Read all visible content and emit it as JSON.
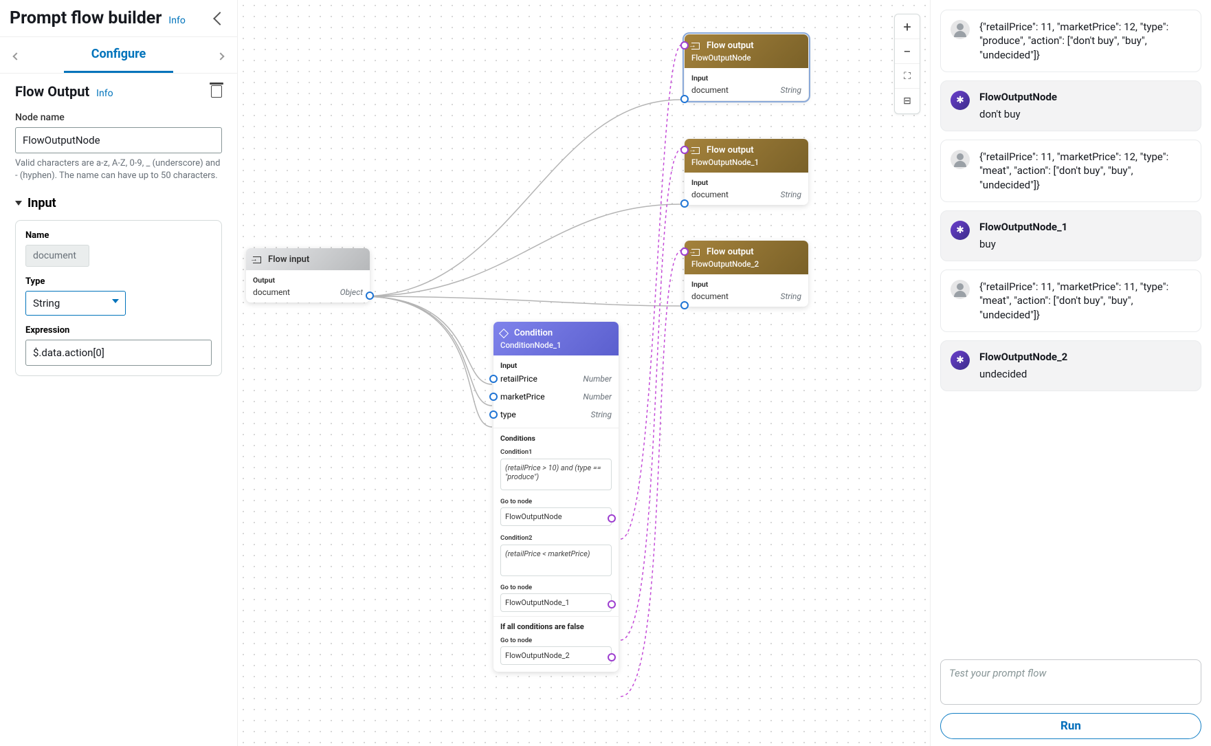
{
  "header": {
    "title": "Prompt flow builder",
    "info": "Info"
  },
  "tabs": {
    "active": "Configure"
  },
  "config": {
    "section_title": "Flow Output",
    "info": "Info",
    "node_name_label": "Node name",
    "node_name_value": "FlowOutputNode",
    "node_name_hint": "Valid characters are a-z, A-Z, 0-9, _ (underscore) and - (hyphen). The name can have up to 50 characters.",
    "input_header": "Input",
    "name_label": "Name",
    "name_value": "document",
    "type_label": "Type",
    "type_value": "String",
    "expr_label": "Expression",
    "expr_value": "$.data.action[0]"
  },
  "canvas": {
    "input_node": {
      "title": "Flow input",
      "out_label": "Output",
      "out_name": "document",
      "out_type": "Object"
    },
    "output_nodes": [
      {
        "title": "Flow output",
        "name": "FlowOutputNode",
        "in_label": "Input",
        "in_name": "document",
        "in_type": "String"
      },
      {
        "title": "Flow output",
        "name": "FlowOutputNode_1",
        "in_label": "Input",
        "in_name": "document",
        "in_type": "String"
      },
      {
        "title": "Flow output",
        "name": "FlowOutputNode_2",
        "in_label": "Input",
        "in_name": "document",
        "in_type": "String"
      }
    ],
    "condition": {
      "title": "Condition",
      "name": "ConditionNode_1",
      "in_label": "Input",
      "inputs": [
        {
          "name": "retailPrice",
          "type": "Number"
        },
        {
          "name": "marketPrice",
          "type": "Number"
        },
        {
          "name": "type",
          "type": "String"
        }
      ],
      "conds_label": "Conditions",
      "cond1_label": "Condition1",
      "cond1_expr": "(retailPrice > 10) and (type == \"produce\")",
      "goto_label": "Go to node",
      "cond1_goto": "FlowOutputNode",
      "cond2_label": "Condition2",
      "cond2_expr": "(retailPrice < marketPrice)",
      "cond2_goto": "FlowOutputNode_1",
      "else_label": "If all conditions are false",
      "else_goto": "FlowOutputNode_2"
    }
  },
  "chat": [
    {
      "role": "user",
      "text": "{\"retailPrice\": 11, \"marketPrice\": 12, \"type\": \"produce\", \"action\": [\"don't buy\", \"buy\", \"undecided\"]}"
    },
    {
      "role": "ai",
      "title": "FlowOutputNode",
      "text": "don't buy"
    },
    {
      "role": "user",
      "text": "{\"retailPrice\": 11, \"marketPrice\": 12, \"type\": \"meat\", \"action\": [\"don't buy\", \"buy\", \"undecided\"]}"
    },
    {
      "role": "ai",
      "title": "FlowOutputNode_1",
      "text": "buy"
    },
    {
      "role": "user",
      "text": "{\"retailPrice\": 11, \"marketPrice\": 11, \"type\": \"meat\", \"action\": [\"don't buy\", \"buy\", \"undecided\"]}"
    },
    {
      "role": "ai",
      "title": "FlowOutputNode_2",
      "text": "undecided"
    }
  ],
  "prompt": {
    "placeholder": "Test your prompt flow",
    "run": "Run"
  }
}
